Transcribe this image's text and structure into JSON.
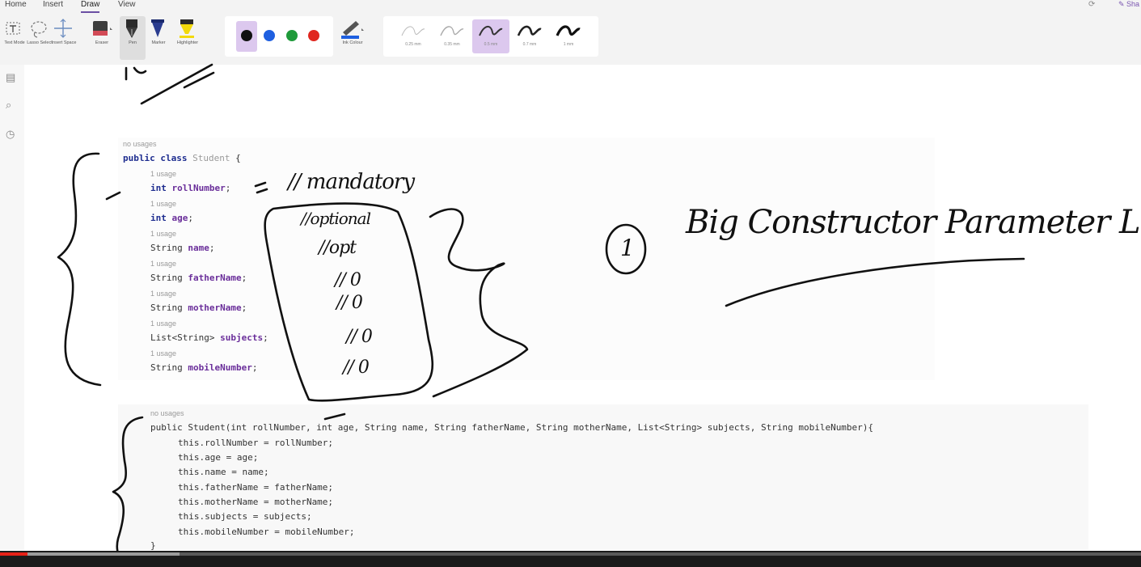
{
  "menu": {
    "tabs": [
      "Home",
      "Insert",
      "Draw",
      "View"
    ],
    "active_tab": "Draw",
    "share_label": "Sha"
  },
  "ribbon": {
    "tools": [
      {
        "id": "text-mode",
        "label": "Text Mode"
      },
      {
        "id": "lasso",
        "label": "Lasso Select"
      },
      {
        "id": "insert-space",
        "label": "Insert Space"
      },
      {
        "id": "eraser",
        "label": "Eraser"
      },
      {
        "id": "pen",
        "label": "Pen"
      },
      {
        "id": "marker",
        "label": "Marker"
      },
      {
        "id": "highlighter",
        "label": "Highlighter"
      }
    ],
    "active_tool": "pen",
    "colors": [
      "#111111",
      "#1e5fe0",
      "#1f9a3a",
      "#e0261e"
    ],
    "active_color": "#111111",
    "ink_colour_label": "Ink Colour",
    "thickness": [
      "0.25 mm",
      "0.35 mm",
      "0.5 mm",
      "0.7 mm",
      "1 mm"
    ],
    "active_thickness": "0.5 mm"
  },
  "code_block_1": {
    "hint_top": "no usages",
    "class_decl": {
      "kw": "public class",
      "name": "Student",
      "brace": "{"
    },
    "usage_hint": "1 usage",
    "fields": [
      {
        "type": "int",
        "name": "rollNumber",
        "type_is_kw": true
      },
      {
        "type": "int",
        "name": "age",
        "type_is_kw": true
      },
      {
        "type": "String",
        "name": "name",
        "type_is_kw": false
      },
      {
        "type": "String",
        "name": "fatherName",
        "type_is_kw": false
      },
      {
        "type": "String",
        "name": "motherName",
        "type_is_kw": false
      },
      {
        "type": "List<String>",
        "name": "subjects",
        "type_is_kw": false
      },
      {
        "type": "String",
        "name": "mobileNumber",
        "type_is_kw": false
      }
    ]
  },
  "code_block_2": {
    "hint_top": "no usages",
    "constructor": "public Student(int rollNumber, int age, String name, String fatherName, String motherName, List<String> subjects, String mobileNumber){",
    "assignments": [
      "this.rollNumber = rollNumber;",
      "this.age = age;",
      "this.name = name;",
      "this.fatherName = fatherName;",
      "this.motherName = motherName;",
      "this.subjects = subjects;",
      "this.mobileNumber = mobileNumber;"
    ],
    "closing": "}"
  },
  "handwriting": {
    "mandatory": "// mandatory",
    "optional": "//optional",
    "opt": "//opt",
    "zeros": [
      "// 0",
      "// 0",
      "// 0",
      "// 0"
    ],
    "number_one": "1",
    "heading": "Big Constructor Parameter List"
  },
  "video": {
    "played_fraction": 0.024,
    "buffered_fraction": 0.157
  }
}
